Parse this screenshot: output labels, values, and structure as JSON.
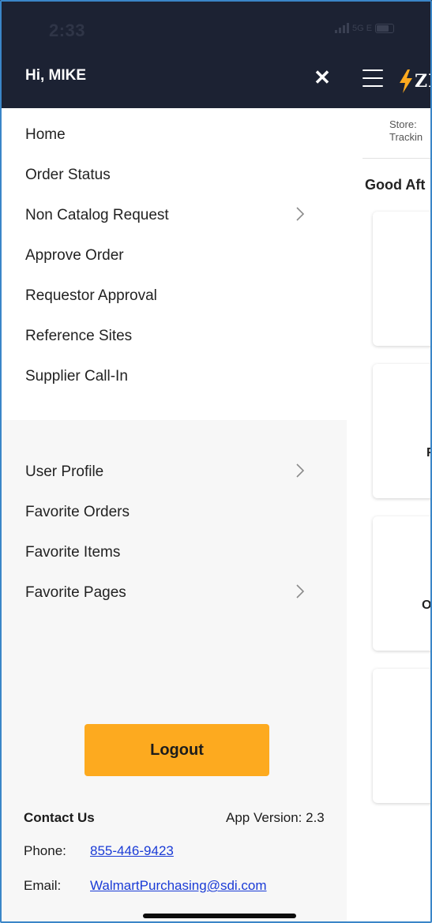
{
  "status_bar": {
    "time": "2:33",
    "network": "5G E"
  },
  "drawer": {
    "greeting": "Hi, MIKE",
    "close_icon": "✕",
    "main_menu": [
      {
        "label": "Home",
        "has_submenu": false
      },
      {
        "label": "Order Status",
        "has_submenu": false
      },
      {
        "label": "Non Catalog Request",
        "has_submenu": true
      },
      {
        "label": "Approve Order",
        "has_submenu": false
      },
      {
        "label": "Requestor Approval",
        "has_submenu": false
      },
      {
        "label": "Reference Sites",
        "has_submenu": false
      },
      {
        "label": "Supplier Call-In",
        "has_submenu": false
      }
    ],
    "secondary_menu": [
      {
        "label": "User Profile",
        "has_submenu": true
      },
      {
        "label": "Favorite Orders",
        "has_submenu": false
      },
      {
        "label": "Favorite Items",
        "has_submenu": false
      },
      {
        "label": "Favorite Pages",
        "has_submenu": true
      }
    ],
    "logout_label": "Logout",
    "contact": {
      "title": "Contact Us",
      "app_version": "App Version: 2.3",
      "phone_label": "Phone:",
      "phone": "855-446-9423",
      "email_label": "Email:",
      "email": "WalmartPurchasing@sdi.com"
    }
  },
  "background_page": {
    "logo_text": "ZE",
    "store_label": "Store:",
    "tracking_label": "Trackin",
    "greeting": "Good Aft",
    "card_fragment_1": "F",
    "card_fragment_2": "O"
  },
  "colors": {
    "header_bg": "#1c2233",
    "accent": "#fdaa1f",
    "link": "#1a3bd6"
  }
}
